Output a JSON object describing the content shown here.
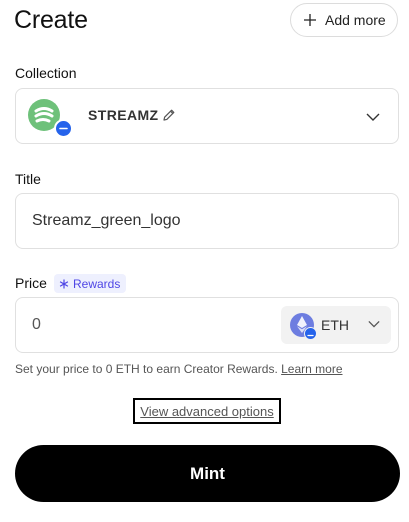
{
  "header": {
    "title": "Create",
    "add_more_label": "Add more"
  },
  "collection": {
    "label": "Collection",
    "name": "STREAMZ"
  },
  "title_field": {
    "label": "Title",
    "value": "Streamz_green_logo"
  },
  "price": {
    "label": "Price",
    "rewards_badge": "Rewards",
    "value": "0",
    "currency": "ETH",
    "help_text": "Set your price to 0 ETH to earn Creator Rewards.",
    "learn_more": "Learn more"
  },
  "advanced_options_label": "View advanced options",
  "mint_label": "Mint",
  "colors": {
    "collection_avatar": "#6ec17a",
    "chain_badge": "#2563eb",
    "rewards_text": "#4f46e5",
    "eth_icon": "#6d7de0",
    "primary_button": "#000000"
  }
}
